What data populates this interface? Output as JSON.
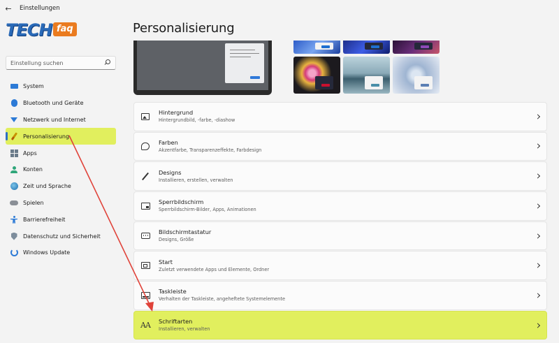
{
  "window": {
    "title": "Einstellungen",
    "back_glyph": "←"
  },
  "logo": {
    "text_main": "TECH",
    "text_badge": "faq"
  },
  "search": {
    "placeholder": "Einstellung suchen"
  },
  "sidebar": {
    "items": [
      {
        "label": "System",
        "icon": "system-icon",
        "active": false
      },
      {
        "label": "Bluetooth und Geräte",
        "icon": "bluetooth-icon",
        "active": false
      },
      {
        "label": "Netzwerk und Internet",
        "icon": "network-icon",
        "active": false
      },
      {
        "label": "Personalisierung",
        "icon": "brush-icon",
        "active": true
      },
      {
        "label": "Apps",
        "icon": "apps-icon",
        "active": false
      },
      {
        "label": "Konten",
        "icon": "account-icon",
        "active": false
      },
      {
        "label": "Zeit und Sprache",
        "icon": "globe-icon",
        "active": false
      },
      {
        "label": "Spielen",
        "icon": "gamepad-icon",
        "active": false
      },
      {
        "label": "Barrierefreiheit",
        "icon": "accessibility-icon",
        "active": false
      },
      {
        "label": "Datenschutz und Sicherheit",
        "icon": "shield-icon",
        "active": false
      },
      {
        "label": "Windows Update",
        "icon": "update-icon",
        "active": false
      }
    ]
  },
  "main": {
    "title": "Personalisierung",
    "cards": [
      {
        "title": "Hintergrund",
        "subtitle": "Hintergrundbild, -farbe, -diashow",
        "icon": "image-icon"
      },
      {
        "title": "Farben",
        "subtitle": "Akzentfarbe, Transparenzeffekte, Farbdesign",
        "icon": "palette-icon"
      },
      {
        "title": "Designs",
        "subtitle": "Installieren, erstellen, verwalten",
        "icon": "brush-icon"
      },
      {
        "title": "Sperrbildschirm",
        "subtitle": "Sperrbildschirm-Bilder, Apps, Animationen",
        "icon": "lock-screen-icon"
      },
      {
        "title": "Bildschirmtastatur",
        "subtitle": "Designs, Größe",
        "icon": "keyboard-icon"
      },
      {
        "title": "Start",
        "subtitle": "Zuletzt verwendete Apps und Elemente, Ordner",
        "icon": "start-icon"
      },
      {
        "title": "Taskleiste",
        "subtitle": "Verhalten der Taskleiste, angeheftete Systemelemente",
        "icon": "taskbar-icon"
      },
      {
        "title": "Schriftarten",
        "subtitle": "Installieren, verwalten",
        "icon": "font-icon"
      }
    ],
    "highlighted_card": "Schriftarten"
  },
  "colors": {
    "highlight": "#e1ef5e",
    "accent": "#2d6fc4",
    "annotation_arrow": "#e0433a"
  }
}
